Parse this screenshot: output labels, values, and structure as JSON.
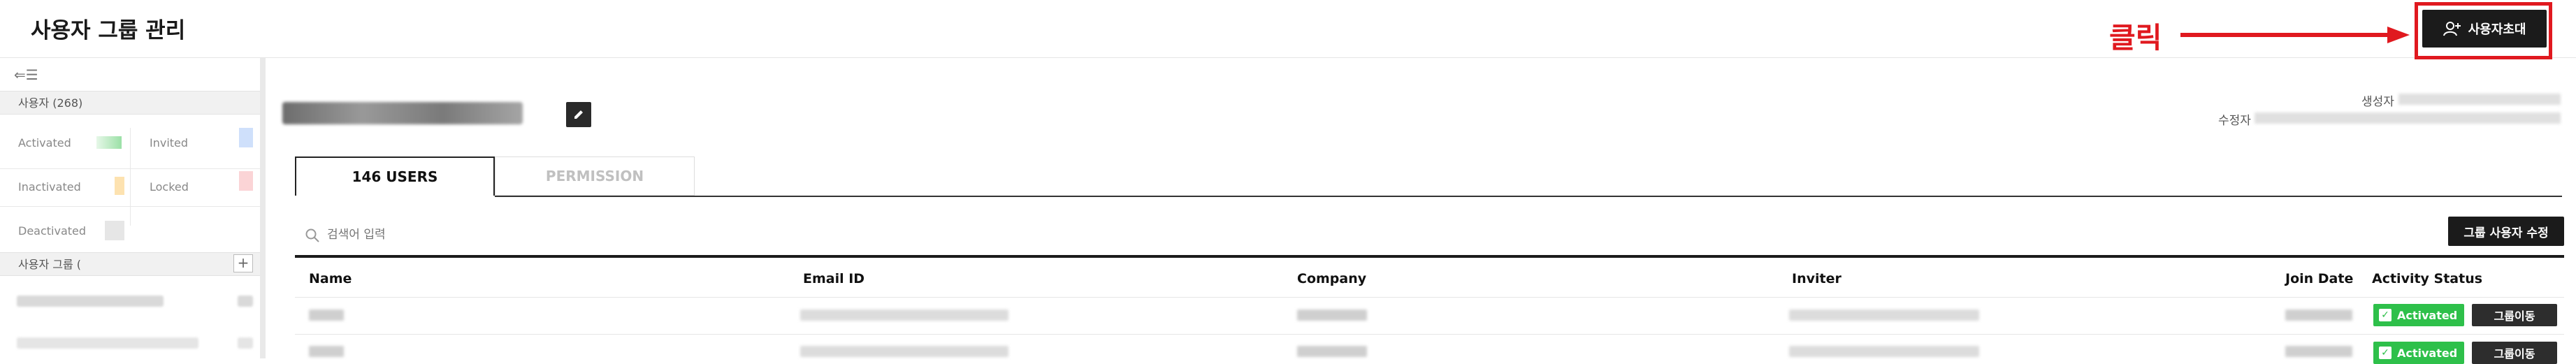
{
  "header": {
    "title": "사용자 그룹 관리",
    "invite_button": "사용자초대",
    "annotation": "클릭",
    "annotation_color": "#e0191f"
  },
  "sidebar": {
    "users_section": "사용자 (268)",
    "stats": {
      "activated": "Activated",
      "invited": "Invited",
      "inactivated": "Inactivated",
      "locked": "Locked",
      "deactivated": "Deactivated"
    },
    "groups_section": "사용자 그룹 (",
    "add_icon": "plus-icon"
  },
  "main": {
    "created_label": "생성자",
    "modified_label": "수정자",
    "tabs": [
      {
        "label": "146 USERS",
        "active": true
      },
      {
        "label": "PERMISSION",
        "active": false
      }
    ],
    "search_placeholder": "검색어 입력",
    "edit_users_button": "그룹 사용자 수정",
    "columns": [
      "Name",
      "Email ID",
      "Company",
      "Inviter",
      "Join Date",
      "Activity Status"
    ],
    "rows": [
      {
        "status": "Activated",
        "action": "그룹이동"
      },
      {
        "status": "Activated",
        "action": "그룹이동"
      }
    ]
  },
  "colors": {
    "accent": "#1b1b1b",
    "activated": "#2ec04a",
    "highlight": "#e0191f"
  }
}
